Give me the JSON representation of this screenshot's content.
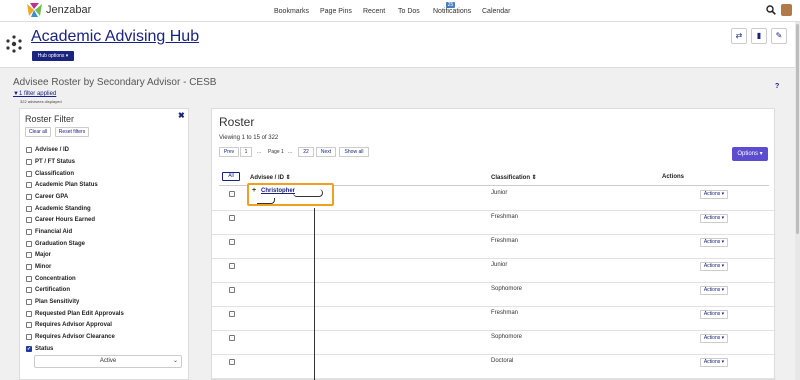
{
  "topbar": {
    "brand": "Jenzabar",
    "nav": [
      "Bookmarks",
      "Page Pins",
      "Recent",
      "To Dos",
      "Notifications",
      "Calendar"
    ],
    "notification_count": "25"
  },
  "hub": {
    "title": "Academic Advising Hub",
    "options_label": "Hub options ▾"
  },
  "section": {
    "title": "Advisee Roster by Secondary Advisor - CESB",
    "filter_applied": "1 filter applied",
    "advisees_displayed": "322 advisees displayed",
    "help": "?"
  },
  "roster_filter": {
    "title": "Roster Filter",
    "clear_all": "Clear all",
    "reset_filters": "Reset filters",
    "items": [
      {
        "label": "Advisee / ID",
        "checked": false
      },
      {
        "label": "PT / FT Status",
        "checked": false
      },
      {
        "label": "Classification",
        "checked": false
      },
      {
        "label": "Academic Plan Status",
        "checked": false
      },
      {
        "label": "Career GPA",
        "checked": false
      },
      {
        "label": "Academic Standing",
        "checked": false
      },
      {
        "label": "Career Hours Earned",
        "checked": false
      },
      {
        "label": "Financial Aid",
        "checked": false
      },
      {
        "label": "Graduation Stage",
        "checked": false
      },
      {
        "label": "Major",
        "checked": false
      },
      {
        "label": "Minor",
        "checked": false
      },
      {
        "label": "Concentration",
        "checked": false
      },
      {
        "label": "Certification",
        "checked": false
      },
      {
        "label": "Plan Sensitivity",
        "checked": false
      },
      {
        "label": "Requested Plan Edit Approvals",
        "checked": false
      },
      {
        "label": "Requires Advisor Approval",
        "checked": false
      },
      {
        "label": "Requires Advisor Clearance",
        "checked": false
      },
      {
        "label": "Status",
        "checked": true
      }
    ],
    "status_value": "Active"
  },
  "roster": {
    "title": "Roster",
    "viewing": "Viewing 1 to 15 of 322",
    "pagination": {
      "prev": "Prev",
      "first": "1",
      "ellipsis": "...",
      "current": "Page 1",
      "last": "22",
      "next": "Next",
      "show_all": "Show all"
    },
    "options_label": "Options ▾",
    "all_label": "All",
    "columns": {
      "advisee": "Advisee / ID ⇕",
      "classification": "Classification ⇕",
      "actions": "Actions"
    },
    "highlighted_name": "Christopher",
    "action_label": "Actions ▾",
    "rows": [
      {
        "classification": "Junior"
      },
      {
        "classification": "Freshman"
      },
      {
        "classification": "Freshman"
      },
      {
        "classification": "Junior"
      },
      {
        "classification": "Sophomore"
      },
      {
        "classification": "Freshman"
      },
      {
        "classification": "Sophomore"
      },
      {
        "classification": "Doctoral"
      }
    ]
  }
}
